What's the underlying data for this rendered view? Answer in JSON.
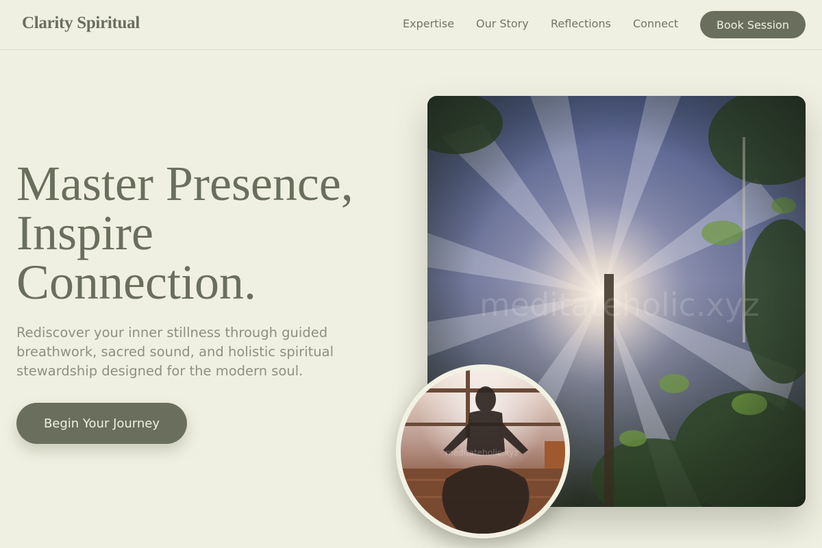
{
  "brand": {
    "name": "Clarity Spiritual"
  },
  "nav": {
    "items": [
      {
        "label": "Expertise"
      },
      {
        "label": "Our Story"
      },
      {
        "label": "Reflections"
      },
      {
        "label": "Connect"
      }
    ],
    "cta_label": "Book Session"
  },
  "hero": {
    "title_lines": [
      "Master Presence,",
      "Inspire",
      "Connection."
    ],
    "subtitle": "Rediscover your inner stillness through guided breathwork, sacred sound, and holistic spiritual stewardship designed for the modern soul.",
    "cta_label": "Begin Your Journey"
  },
  "images": {
    "forest_watermark": "meditateholic.xyz",
    "meditation_watermark": "meditateholic.xyz"
  },
  "colors": {
    "background": "#f0f0e2",
    "primary": "#6a6f5d",
    "button_text": "#f0f0e2",
    "subtitle_text": "#8c9080"
  }
}
